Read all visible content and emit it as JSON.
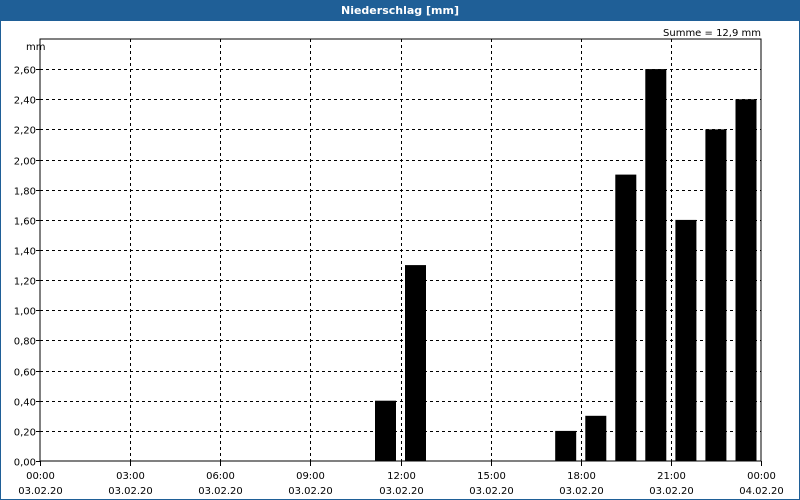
{
  "window": {
    "title": "Niederschlag [mm]"
  },
  "chart_data": {
    "type": "bar",
    "title": "Niederschlag [mm]",
    "ylabel": "mm",
    "annotation": "Summe = 12,9 mm",
    "ylim": [
      0,
      2.8
    ],
    "yticks": [
      "0,00",
      "0,20",
      "0,40",
      "0,60",
      "0,80",
      "1,00",
      "1,20",
      "1,40",
      "1,60",
      "1,80",
      "2,00",
      "2,20",
      "2,40",
      "2,60"
    ],
    "xticks": [
      {
        "time": "00:00",
        "date": "03.02.20"
      },
      {
        "time": "03:00",
        "date": "03.02.20"
      },
      {
        "time": "06:00",
        "date": "03.02.20"
      },
      {
        "time": "09:00",
        "date": "03.02.20"
      },
      {
        "time": "12:00",
        "date": "03.02.20"
      },
      {
        "time": "15:00",
        "date": "03.02.20"
      },
      {
        "time": "18:00",
        "date": "03.02.20"
      },
      {
        "time": "21:00",
        "date": "03.02.20"
      },
      {
        "time": "00:00",
        "date": "04.02.20"
      }
    ],
    "x_hours": [
      0.5,
      1.5,
      2.5,
      3.5,
      4.5,
      5.5,
      6.5,
      7.5,
      8.5,
      9.5,
      10.5,
      11.5,
      12.5,
      13.5,
      14.5,
      15.5,
      16.5,
      17.5,
      18.5,
      19.5,
      20.5,
      21.5,
      22.5,
      23.5
    ],
    "values": [
      0,
      0,
      0,
      0,
      0,
      0,
      0,
      0,
      0,
      0,
      0,
      0.4,
      1.3,
      0,
      0,
      0,
      0,
      0.2,
      0.3,
      1.9,
      2.6,
      1.6,
      2.2,
      2.4
    ],
    "grid": true,
    "bar_color": "#000000"
  }
}
